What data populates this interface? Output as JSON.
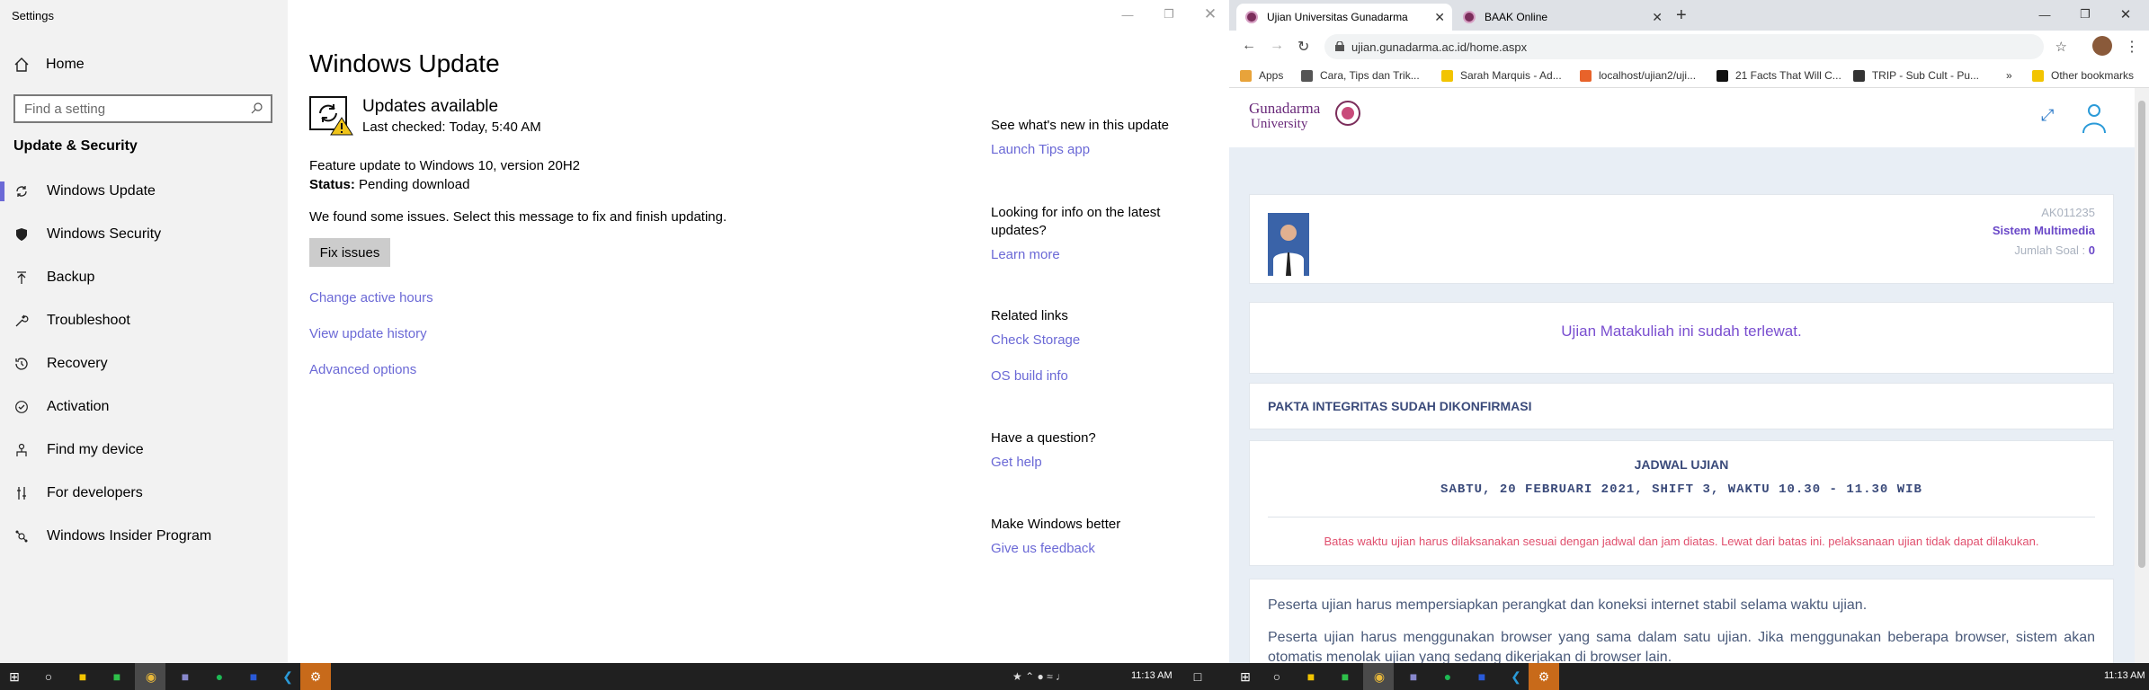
{
  "settings": {
    "window_title": "Settings",
    "home_label": "Home",
    "search_placeholder": "Find a setting",
    "section_title": "Update & Security",
    "nav_items": [
      {
        "label": "Windows Update",
        "icon": "refresh-icon"
      },
      {
        "label": "Windows Security",
        "icon": "shield-icon"
      },
      {
        "label": "Backup",
        "icon": "upload-arrow-icon"
      },
      {
        "label": "Troubleshoot",
        "icon": "wrench-icon"
      },
      {
        "label": "Recovery",
        "icon": "history-icon"
      },
      {
        "label": "Activation",
        "icon": "check-circle-icon"
      },
      {
        "label": "Find my device",
        "icon": "person-pin-icon"
      },
      {
        "label": "For developers",
        "icon": "developer-icon"
      },
      {
        "label": "Windows Insider Program",
        "icon": "insider-icon"
      }
    ],
    "main": {
      "title": "Windows Update",
      "status_title": "Updates available",
      "last_checked": "Last checked: Today, 5:40 AM",
      "feature_update": "Feature update to Windows 10, version 20H2",
      "status_label": "Status:",
      "status_value": " Pending download",
      "issue_text": "We found some issues. Select this message to fix and finish updating.",
      "fix_button": "Fix issues",
      "links": [
        "Change active hours",
        "View update history",
        "Advanced options"
      ]
    },
    "right": {
      "whats_new_heading": "See what's new in this update",
      "launch_tips": "Launch Tips app",
      "looking_heading": "Looking for info on the latest updates?",
      "learn_more": "Learn more",
      "related_heading": "Related links",
      "check_storage": "Check Storage",
      "os_build": "OS build info",
      "question_heading": "Have a question?",
      "get_help": "Get help",
      "better_heading": "Make Windows better",
      "feedback": "Give us feedback"
    }
  },
  "browser": {
    "tabs": [
      {
        "title": "Ujian Universitas Gunadarma",
        "active": true
      },
      {
        "title": "BAAK Online",
        "active": false
      }
    ],
    "url": "ujian.gunadarma.ac.id/home.aspx",
    "bookmarks": [
      "Apps",
      "Cara, Tips dan Trik...",
      "Sarah Marquis - Ad...",
      "localhost/ujian2/uji...",
      "21 Facts That Will C...",
      "TRIP - Sub Cult - Pu..."
    ],
    "other_bookmarks": "Other bookmarks",
    "page": {
      "logo_text": "Gunadarma University",
      "code": "AK011235",
      "course": "Sistem Multimedia",
      "jumlah_label": "Jumlah Soal : ",
      "jumlah_value": "0",
      "late_message": "Ujian Matakuliah ini sudah terlewat.",
      "pakta": "PAKTA INTEGRITAS SUDAH DIKONFIRMASI",
      "jadwal_heading": "JADWAL UJIAN",
      "jadwal_detail": "SABTU, 20 FEBRUARI 2021, SHIFT 3, WAKTU 10.30 - 11.30 WIB",
      "warning": "Batas waktu ujian harus dilaksanakan sesuai dengan jadwal dan jam diatas. Lewat dari batas ini. pelaksanaan ujian tidak dapat dilakukan.",
      "para1": "Peserta ujian harus mempersiapkan perangkat dan koneksi internet stabil selama waktu ujian.",
      "para2": "Peserta ujian harus menggunakan browser yang sama dalam satu ujian. Jika menggunakan beberapa browser, sistem akan otomatis menolak ujian yang sedang dikerjakan di browser lain."
    }
  },
  "taskbar": {
    "clock_left": "11:13 AM",
    "clock_right": "11:13 AM"
  }
}
